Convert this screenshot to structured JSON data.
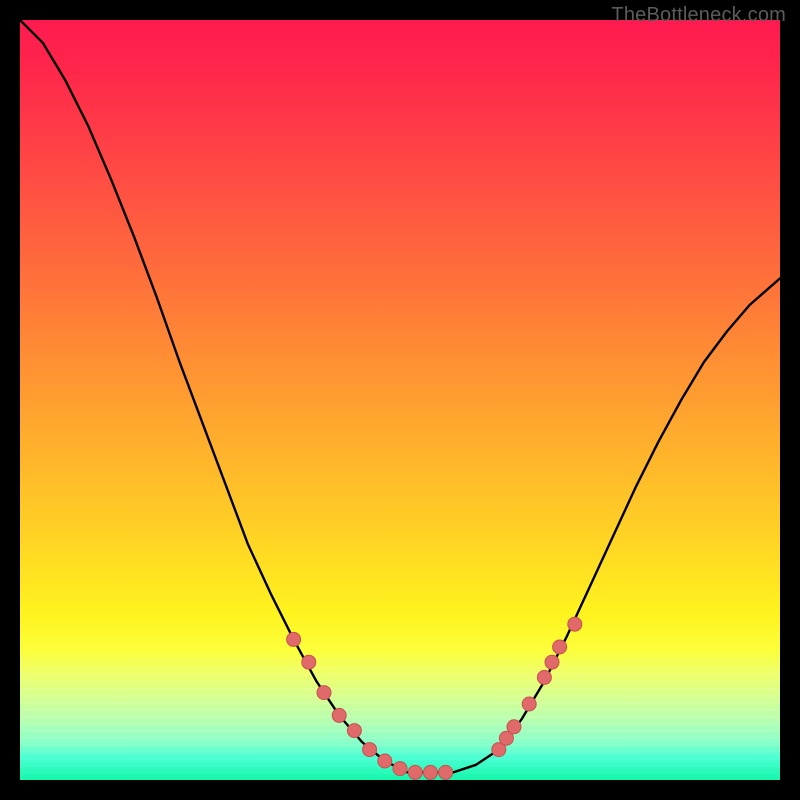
{
  "watermark": "TheBottleneck.com",
  "colors": {
    "curve": "#000000",
    "marker_fill": "#e06a6a",
    "marker_stroke": "#c94f4f"
  },
  "chart_data": {
    "type": "line",
    "title": "",
    "xlabel": "",
    "ylabel": "",
    "xlim": [
      0,
      100
    ],
    "ylim": [
      0,
      100
    ],
    "x": [
      0,
      3,
      6,
      9,
      12,
      15,
      18,
      21,
      24,
      27,
      30,
      33,
      36,
      39,
      42,
      45,
      48,
      51,
      54,
      57,
      60,
      63,
      66,
      69,
      72,
      75,
      78,
      81,
      84,
      87,
      90,
      93,
      96,
      100
    ],
    "values": [
      100,
      97,
      92,
      86,
      79,
      71.5,
      63.5,
      55,
      47,
      39,
      31,
      24.5,
      18.5,
      13,
      8.5,
      5,
      2.5,
      1,
      1,
      1,
      2,
      4,
      8,
      13,
      19,
      25.5,
      32,
      38.5,
      44.5,
      50,
      55,
      59,
      62.5,
      66
    ],
    "series": [
      {
        "name": "bottleneck-curve",
        "x": [
          0,
          3,
          6,
          9,
          12,
          15,
          18,
          21,
          24,
          27,
          30,
          33,
          36,
          39,
          42,
          45,
          48,
          51,
          54,
          57,
          60,
          63,
          66,
          69,
          72,
          75,
          78,
          81,
          84,
          87,
          90,
          93,
          96,
          100
        ],
        "y": [
          100,
          97,
          92,
          86,
          79,
          71.5,
          63.5,
          55,
          47,
          39,
          31,
          24.5,
          18.5,
          13,
          8.5,
          5,
          2.5,
          1,
          1,
          1,
          2,
          4,
          8,
          13,
          19,
          25.5,
          32,
          38.5,
          44.5,
          50,
          55,
          59,
          62.5,
          66
        ]
      }
    ],
    "markers": [
      {
        "x": 36,
        "y": 18.5
      },
      {
        "x": 38,
        "y": 15.5
      },
      {
        "x": 40,
        "y": 11.5
      },
      {
        "x": 42,
        "y": 8.5
      },
      {
        "x": 44,
        "y": 6.5
      },
      {
        "x": 46,
        "y": 4
      },
      {
        "x": 48,
        "y": 2.5
      },
      {
        "x": 50,
        "y": 1.5
      },
      {
        "x": 52,
        "y": 1
      },
      {
        "x": 54,
        "y": 1
      },
      {
        "x": 56,
        "y": 1
      },
      {
        "x": 63,
        "y": 4
      },
      {
        "x": 64,
        "y": 5.5
      },
      {
        "x": 65,
        "y": 7
      },
      {
        "x": 67,
        "y": 10
      },
      {
        "x": 69,
        "y": 13.5
      },
      {
        "x": 70,
        "y": 15.5
      },
      {
        "x": 71,
        "y": 17.5
      },
      {
        "x": 73,
        "y": 20.5
      }
    ]
  }
}
